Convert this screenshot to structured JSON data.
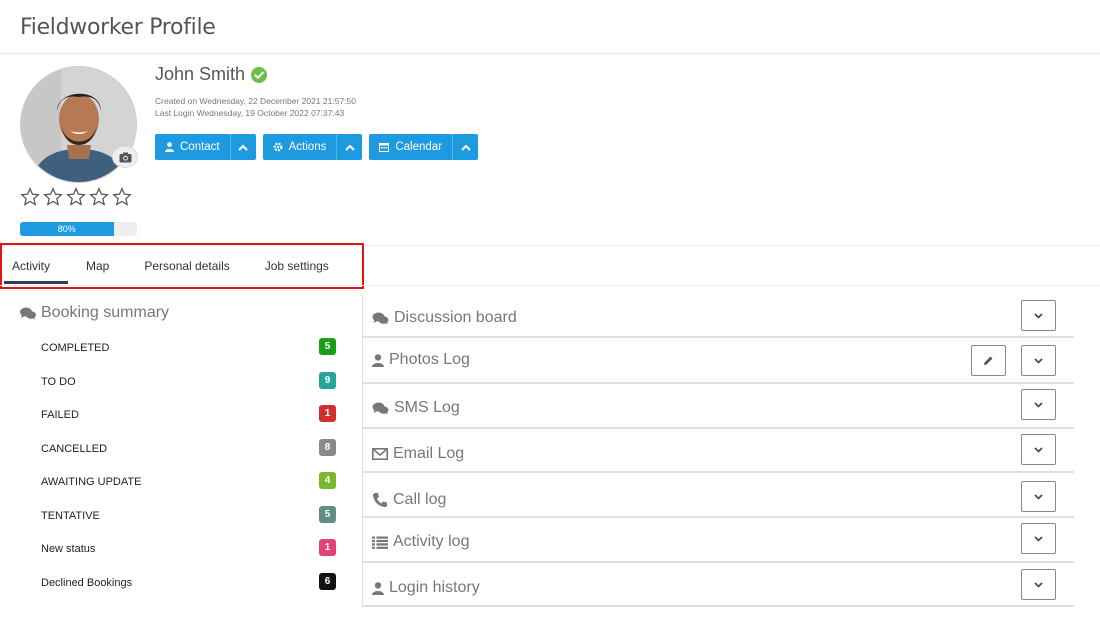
{
  "page": {
    "title": "Fieldworker Profile"
  },
  "profile": {
    "name": "John Smith",
    "created": "Created on Wednesday, 22 December 2021 21:57:50",
    "last_login": "Last Login Wednesday, 19 October 2022 07:37:43",
    "rating": 0,
    "rating_max": 5,
    "progress_label": "80%",
    "progress_value": 0.8,
    "verified_icon": "check-circle-icon"
  },
  "actions": [
    {
      "label": "Contact",
      "icon": "user-icon"
    },
    {
      "label": "Actions",
      "icon": "gear-icon"
    },
    {
      "label": "Calendar",
      "icon": "calendar-icon"
    }
  ],
  "tabs": [
    {
      "label": "Activity",
      "active": true
    },
    {
      "label": "Map",
      "active": false
    },
    {
      "label": "Personal details",
      "active": false
    },
    {
      "label": "Job settings",
      "active": false
    }
  ],
  "booking_summary": {
    "title": "Booking summary",
    "items": [
      {
        "label": "COMPLETED",
        "count": "5",
        "color": "#1a9f1a"
      },
      {
        "label": "TO DO",
        "count": "9",
        "color": "#26a69a"
      },
      {
        "label": "FAILED",
        "count": "1",
        "color": "#d32f2f"
      },
      {
        "label": "CANCELLED",
        "count": "8",
        "color": "#8a8a8a"
      },
      {
        "label": "AWAITING UPDATE",
        "count": "4",
        "color": "#7cb82f"
      },
      {
        "label": "TENTATIVE",
        "count": "5",
        "color": "#5f8f82"
      },
      {
        "label": "New status",
        "count": "1",
        "color": "#e0437a"
      },
      {
        "label": "Declined Bookings",
        "count": "6",
        "color": "#111111"
      }
    ]
  },
  "panels": [
    {
      "title": "Discussion board",
      "icon": "comments-icon",
      "edit": false
    },
    {
      "title": "Photos Log",
      "icon": "user-icon",
      "edit": true
    },
    {
      "title": "SMS Log",
      "icon": "comments-icon",
      "edit": false
    },
    {
      "title": "Email Log",
      "icon": "envelope-icon",
      "edit": false
    },
    {
      "title": "Call log",
      "icon": "phone-icon",
      "edit": false
    },
    {
      "title": "Activity log",
      "icon": "list-icon",
      "edit": false
    },
    {
      "title": "Login history",
      "icon": "user-icon",
      "edit": false
    }
  ],
  "colors": {
    "primary": "#1e9be0",
    "tab_outline": "#e01515",
    "tab_underline": "#2c3e50"
  }
}
